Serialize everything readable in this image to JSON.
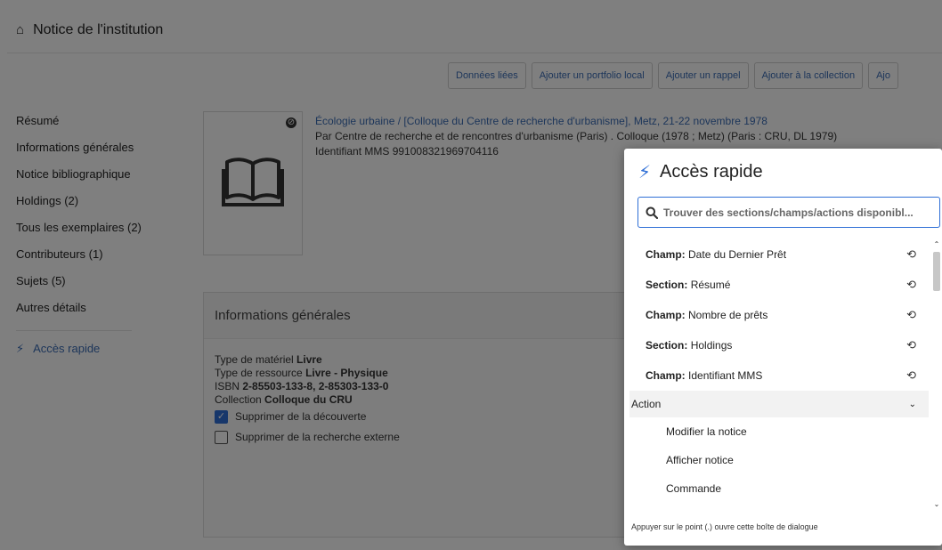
{
  "header": {
    "title": "Notice de l'institution",
    "home_icon": "home-icon"
  },
  "actions": [
    "Données liées",
    "Ajouter un portfolio local",
    "Ajouter un rappel",
    "Ajouter à la collection",
    "Ajo"
  ],
  "sidenav": {
    "items": [
      "Résumé",
      "Informations générales",
      "Notice bibliographique",
      "Holdings (2)",
      "Tous les exemplaires (2)",
      "Contributeurs (1)",
      "Sujets (5)",
      "Autres détails"
    ],
    "quick_access": "Accès rapide"
  },
  "record": {
    "title": "Écologie urbaine / [Colloque du Centre de recherche d'urbanisme], Metz, 21-22 novembre 1978",
    "by_prefix": "Par ",
    "by_value": "Centre de recherche et de rencontres d'urbanisme (Paris) . Colloque (1978 ; Metz) (Paris : CRU, DL 1979)",
    "mms_label": "Identifiant MMS ",
    "mms_value": "991008321969704116"
  },
  "general_info": {
    "heading": "Informations générales",
    "material_label": "Type de matériel ",
    "material_value": "Livre",
    "resource_label": "Type de ressource ",
    "resource_value": "Livre - Physique",
    "isbn_label": "ISBN ",
    "isbn_value": "2-85503-133-8, 2-85303-133-0",
    "collection_label": "Collection ",
    "collection_value": "Colloque du CRU",
    "suppress_discovery": "Supprimer de la découverte",
    "suppress_external": "Supprimer de la recherche externe"
  },
  "dialog": {
    "title": "Accès rapide",
    "search_placeholder": "Trouver des sections/champs/actions disponibl...",
    "rows": [
      {
        "kind": "Champ:",
        "label": "Date du Dernier Prêt"
      },
      {
        "kind": "Section:",
        "label": "Résumé"
      },
      {
        "kind": "Champ:",
        "label": "Nombre de prêts"
      },
      {
        "kind": "Section:",
        "label": "Holdings"
      },
      {
        "kind": "Champ:",
        "label": "Identifiant MMS"
      }
    ],
    "group": "Action",
    "group_items": [
      "Modifier la notice",
      "Afficher notice",
      "Commande"
    ],
    "hint": "Appuyer sur le point (.) ouvre cette boîte de dialogue"
  },
  "colors": {
    "accent": "#2f6fd6",
    "link": "#3b6cb5"
  }
}
